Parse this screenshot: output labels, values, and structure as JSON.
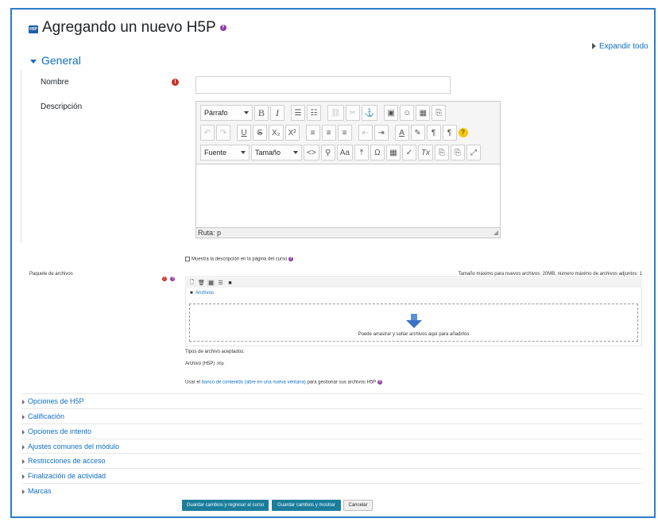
{
  "header": {
    "badge": "H5P",
    "title": "Agregando un nuevo H5P",
    "expand_all": "Expandir todo"
  },
  "general": {
    "section_title": "General",
    "name_label": "Nombre",
    "name_value": "",
    "description_label": "Descripción"
  },
  "editor": {
    "format_select": "Párrafo",
    "font_select": "Fuente",
    "size_select": "Tamaño",
    "toolbar_row1": [
      "B",
      "I",
      "☰",
      "☷",
      "⛓",
      "✂",
      "⚓",
      "▣",
      "☺",
      "▦",
      "⎘"
    ],
    "toolbar_row2": [
      "↶",
      "↷",
      "U",
      "S",
      "X₂",
      "X²",
      "≡",
      "≡",
      "≡",
      "⇤",
      "⇥",
      "A",
      "✎",
      "¶",
      "¶"
    ],
    "toolbar_row3": [
      "<>",
      "⚲",
      "Aa",
      "⤒",
      "Ω",
      "▦",
      "✓",
      "Tx",
      "⎘",
      "⎘",
      "⤢"
    ],
    "help_button": "?",
    "path": "Ruta: p"
  },
  "show_description": "Muestra la descripción en la página del curso",
  "files": {
    "label": "Paquete de archivos",
    "limits": "Tamaño máximo para nuevos archivos: 20MB, número máximo de archivos adjuntos: 1",
    "folder": "Archivos",
    "drop_hint": "Puede arrastrar y soltar archivos aquí para añadirlos",
    "accepted_title": "Tipos de archivo aceptados:",
    "accepted_type": "Archivo (H5P)",
    "accepted_ext": ".h5p",
    "content_bank_prefix": "Usar el",
    "content_bank_link": "banco de contenido (abre en una nueva ventana)",
    "content_bank_suffix": "para gestionar sus archivos H5P"
  },
  "sections": [
    "Opciones de H5P",
    "Calificación",
    "Opciones de intento",
    "Ajustes comunes del módulo",
    "Restricciones de acceso",
    "Finalización de actividad",
    "Marcas"
  ],
  "buttons": {
    "save_return": "Guardar cambios y regresar al curso",
    "save_display": "Guardar cambios y mostrar",
    "cancel": "Cancelar"
  },
  "colors": {
    "link": "#0f6fc5",
    "primary_button": "#1a7d9b",
    "required": "#ca3120",
    "help": "#8e3ca8",
    "frame": "#2f7ec9"
  }
}
